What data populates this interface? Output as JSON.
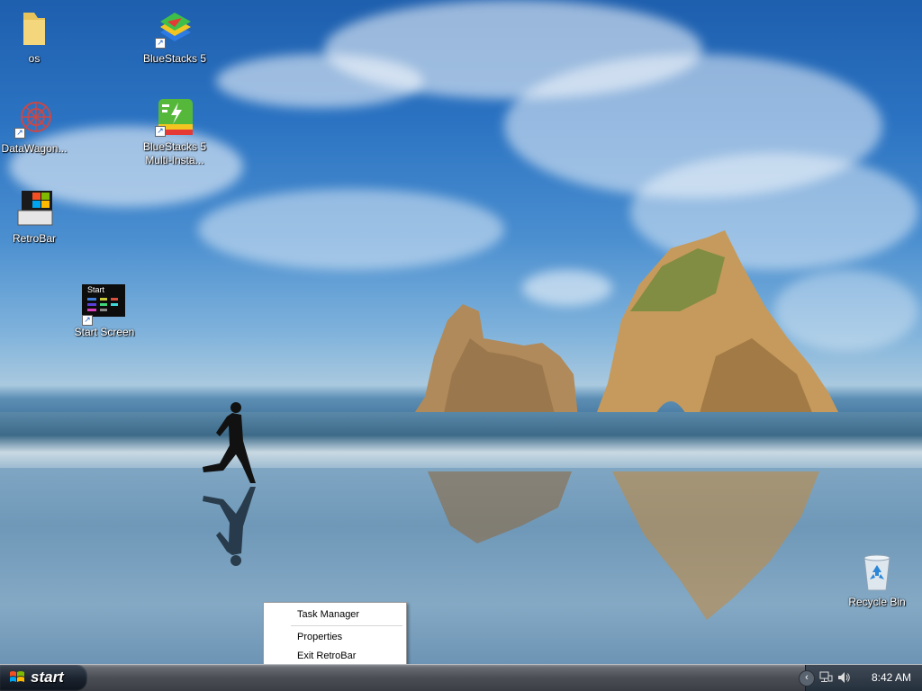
{
  "desktop": {
    "icons": [
      {
        "label": "os",
        "icon": "folder-icon"
      },
      {
        "label": "BlueStacks 5",
        "icon": "bluestacks-icon"
      },
      {
        "label": "DataWagon...",
        "icon": "datawagon-icon"
      },
      {
        "label": "BlueStacks 5 Multi-Insta...",
        "icon": "bluestacks-multi-icon"
      },
      {
        "label": "RetroBar",
        "icon": "retrobar-icon"
      },
      {
        "label": "Start Screen",
        "icon": "start-screen-icon"
      },
      {
        "label": "Recycle Bin",
        "icon": "recycle-bin-icon"
      }
    ],
    "start_screen_thumb_text": "Start"
  },
  "context_menu": {
    "items": [
      "Task Manager",
      "Properties",
      "Exit RetroBar"
    ]
  },
  "taskbar": {
    "start_label": "start",
    "clock": "8:42 AM",
    "tray_icons": [
      "show-hidden-icons-icon",
      "network-icon",
      "volume-icon"
    ]
  },
  "colors": {
    "start_flag_red": "#f25022",
    "start_flag_green": "#7fba00",
    "start_flag_blue": "#00a4ef",
    "start_flag_yellow": "#ffb900"
  }
}
